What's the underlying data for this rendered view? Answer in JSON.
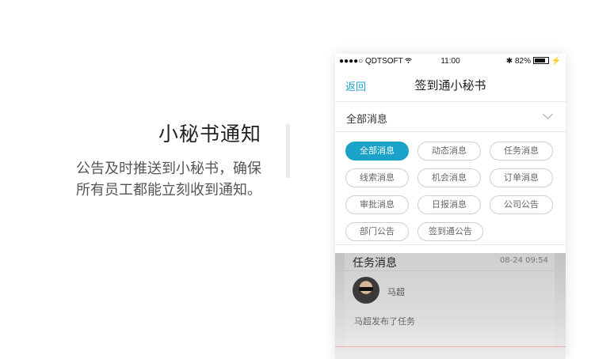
{
  "promo": {
    "title": "小秘书通知",
    "desc_line1": "公告及时推送到小秘书，确保",
    "desc_line2": "所有员工都能立刻收到通知。"
  },
  "statusbar": {
    "carrier": "●●●●○ QDTSOFT",
    "wifi_icon": "wifi-icon",
    "time": "11:00",
    "bluetooth": "✱",
    "battery_pct": "82%"
  },
  "navbar": {
    "back_label": "返回",
    "title": "签到通小秘书"
  },
  "filter": {
    "selected": "全部消息"
  },
  "chips": [
    {
      "label": "全部消息",
      "active": true
    },
    {
      "label": "动态消息",
      "active": false
    },
    {
      "label": "任务消息",
      "active": false
    },
    {
      "label": "线索消息",
      "active": false
    },
    {
      "label": "机会消息",
      "active": false
    },
    {
      "label": "订单消息",
      "active": false
    },
    {
      "label": "审批消息",
      "active": false
    },
    {
      "label": "日报消息",
      "active": false
    },
    {
      "label": "公司公告",
      "active": false
    },
    {
      "label": "部门公告",
      "active": false
    },
    {
      "label": "签到通公告",
      "active": false
    }
  ],
  "card": {
    "title": "任务消息",
    "time": "08-24 09:54",
    "user_name": "马超",
    "message": "马超发布了任务"
  },
  "colors": {
    "accent": "#1aa3c8"
  }
}
